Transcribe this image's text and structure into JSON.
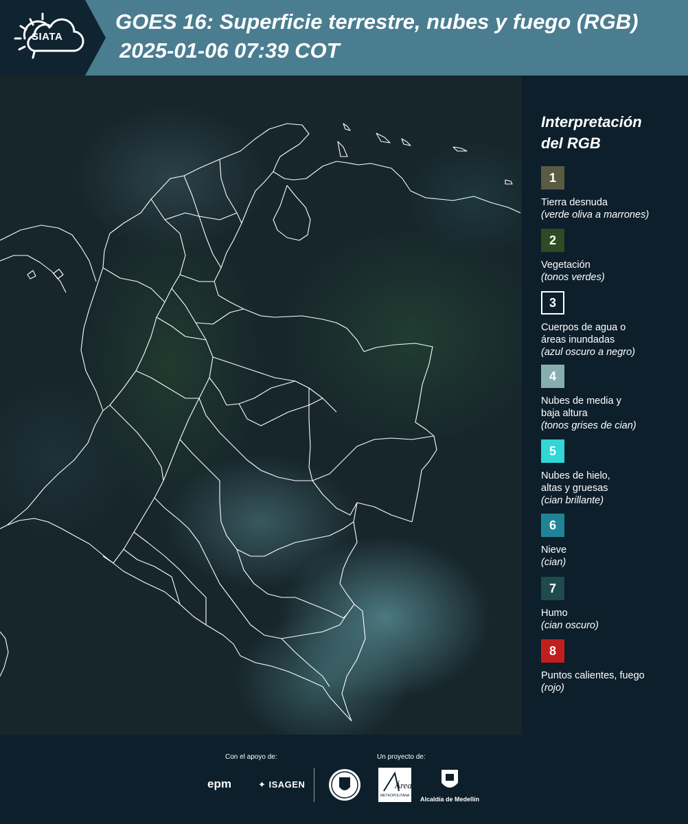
{
  "header": {
    "logo_text": "SIATA",
    "title_line1": "GOES 16: Superficie terrestre, nubes y fuego (RGB)",
    "title_line2": "2025-01-06 07:39 COT"
  },
  "legend": {
    "title_line1": "Interpretación",
    "title_line2": "del RGB",
    "items": [
      {
        "number": "1",
        "color": "#5b5b43",
        "label": "Tierra desnuda",
        "note": "(verde oliva a marrones)"
      },
      {
        "number": "2",
        "color": "#2f4a24",
        "label": "Vegetación",
        "note": "(tonos verdes)"
      },
      {
        "number": "3",
        "color": "#0d1f2b",
        "label": "Cuerpos de agua o áreas inundadas",
        "note": "(azul oscuro a negro)"
      },
      {
        "number": "4",
        "color": "#86aeae",
        "label": "Nubes de media y baja altura",
        "note": "(tonos grises de cian)"
      },
      {
        "number": "5",
        "color": "#31d6d6",
        "label": "Nubes de hielo, altas y gruesas",
        "note": "(cian brillante)"
      },
      {
        "number": "6",
        "color": "#1f8497",
        "label": "Nieve",
        "note": "(cian)"
      },
      {
        "number": "7",
        "color": "#1e4b4d",
        "label": "Humo",
        "note": "(cian oscuro)"
      },
      {
        "number": "8",
        "color": "#c21e1e",
        "label": "Puntos calientes, fuego",
        "note": "(rojo)"
      }
    ]
  },
  "footer": {
    "support_caption": "Con el apoyo de:",
    "project_caption": "Un proyecto de:",
    "sponsor1": "epm",
    "sponsor2": "ISAGEN",
    "area_logo_text": "Área",
    "area_logo_subtext": "METROPOLITANA",
    "alcaldia": "Alcaldía de Medellín"
  },
  "colors": {
    "header_band": "#4a7d90",
    "background": "#0d1f2b",
    "boundary_lines": "#ffffff"
  }
}
